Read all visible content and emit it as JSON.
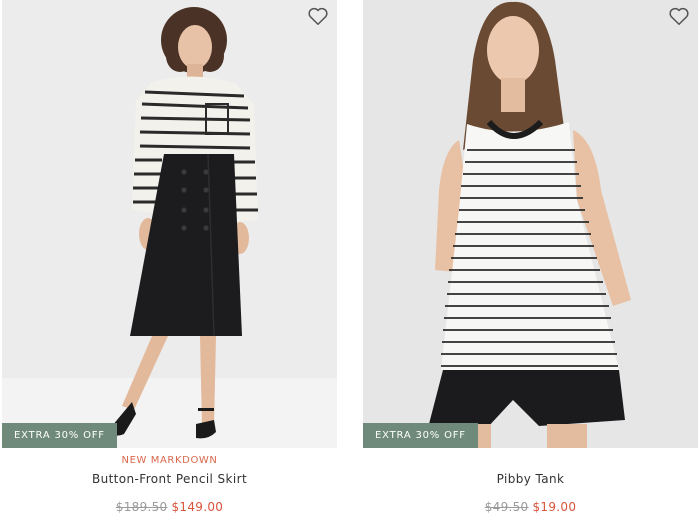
{
  "products": [
    {
      "badge": "EXTRA 30% OFF",
      "tag": "NEW MARKDOWN",
      "name": "Button-Front Pencil Skirt",
      "original_price": "$189.50",
      "sale_price": "$149.00",
      "wishlist_icon": "heart-outline-icon",
      "image": "model-in-striped-blouse-and-black-pencil-skirt"
    },
    {
      "badge": "EXTRA 30% OFF",
      "tag": "",
      "name": "Pibby Tank",
      "original_price": "$49.50",
      "sale_price": "$19.00",
      "wishlist_icon": "heart-outline-icon",
      "image": "model-in-striped-tank-and-black-shorts"
    }
  ],
  "colors": {
    "badge_bg": "#6f8a7a",
    "sale_price": "#d9553a",
    "tag": "#d9684d",
    "original_price": "#9a9a9a"
  }
}
